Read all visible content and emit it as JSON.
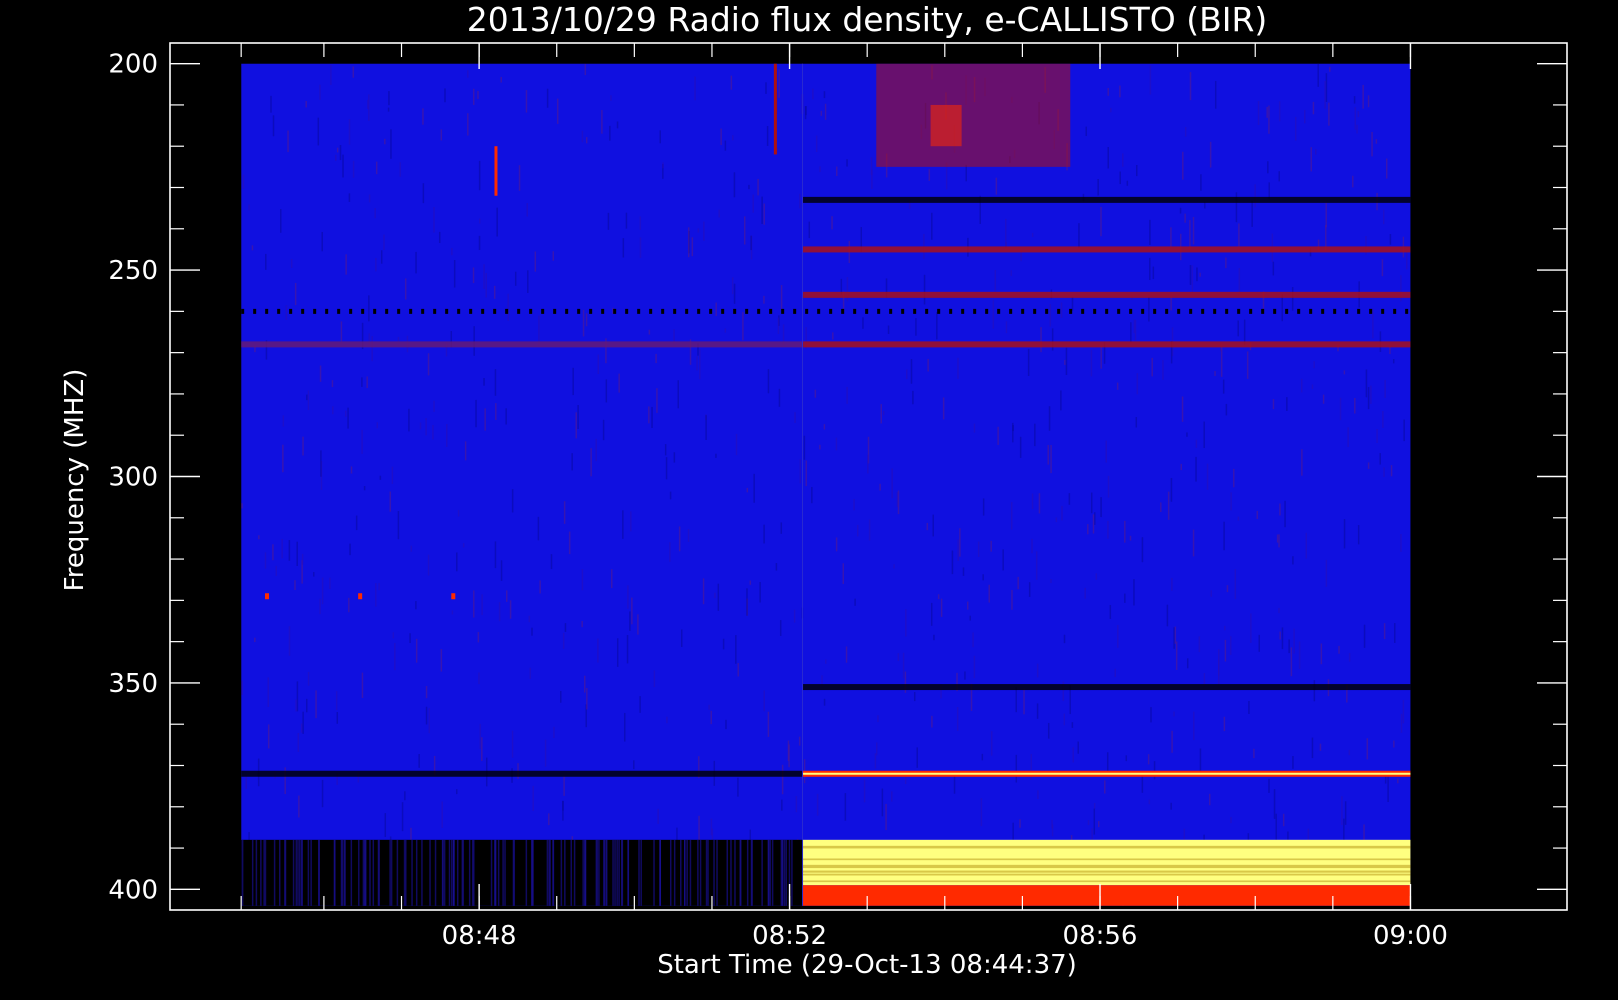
{
  "chart_data": {
    "type": "heatmap",
    "title": "2013/10/29  Radio flux density, e-CALLISTO (BIR)",
    "xlabel": "Start Time (29-Oct-13 08:44:37)",
    "ylabel": "Frequency (MHZ)",
    "x_range_minutes": [
      -0.6,
      17.4
    ],
    "data_x_range_minutes": [
      0.317,
      15.383
    ],
    "y_range_mhz": [
      195,
      405
    ],
    "data_y_range_mhz": [
      200,
      404
    ],
    "y_inverted": true,
    "x_ticks": [
      {
        "label": "08:48",
        "minute": 3.383
      },
      {
        "label": "08:52",
        "minute": 7.383
      },
      {
        "label": "08:56",
        "minute": 11.383
      },
      {
        "label": "09:00",
        "minute": 15.383
      }
    ],
    "y_ticks": [
      {
        "label": "200",
        "mhz": 200
      },
      {
        "label": "250",
        "mhz": 250
      },
      {
        "label": "300",
        "mhz": 300
      },
      {
        "label": "350",
        "mhz": 350
      },
      {
        "label": "400",
        "mhz": 400
      }
    ],
    "colormap": [
      "#000000",
      "#1010e0",
      "#b01010",
      "#ff2a00",
      "#ffff80"
    ],
    "background_color": "#1010e0",
    "regime_change_minute": 7.55,
    "features": [
      {
        "kind": "horizontal-band",
        "mhz": [
          388,
          404
        ],
        "minutes": [
          0.317,
          7.55
        ],
        "level": "low"
      },
      {
        "kind": "horizontal-band",
        "mhz": [
          388,
          399
        ],
        "minutes": [
          7.55,
          15.383
        ],
        "level": "very-high"
      },
      {
        "kind": "horizontal-band",
        "mhz": [
          399,
          404
        ],
        "minutes": [
          7.55,
          15.383
        ],
        "level": "high"
      },
      {
        "kind": "horizontal-line",
        "mhz": 372,
        "minutes": [
          7.55,
          15.383
        ],
        "level": "high"
      },
      {
        "kind": "horizontal-line",
        "mhz": 372,
        "minutes": [
          0.317,
          7.55
        ],
        "level": "low"
      },
      {
        "kind": "horizontal-line",
        "mhz": 351,
        "minutes": [
          7.55,
          15.383
        ],
        "level": "low"
      },
      {
        "kind": "horizontal-line",
        "mhz": 233,
        "minutes": [
          7.55,
          15.383
        ],
        "level": "low"
      },
      {
        "kind": "horizontal-line",
        "mhz": 245,
        "minutes": [
          7.55,
          15.383
        ],
        "level": "medium"
      },
      {
        "kind": "horizontal-line",
        "mhz": 256,
        "minutes": [
          7.55,
          15.383
        ],
        "level": "medium"
      },
      {
        "kind": "horizontal-line",
        "mhz": 268,
        "minutes": [
          7.55,
          15.383
        ],
        "level": "medium"
      },
      {
        "kind": "horizontal-line",
        "mhz": 268,
        "minutes": [
          0.317,
          7.55
        ],
        "level": "medium-faint"
      },
      {
        "kind": "dashed-line",
        "mhz": 260,
        "minutes": [
          0.317,
          15.383
        ],
        "level": "low"
      },
      {
        "kind": "patch",
        "mhz": [
          200,
          225
        ],
        "minutes": [
          8.5,
          11.0
        ],
        "level": "medium"
      },
      {
        "kind": "patch",
        "mhz": [
          210,
          220
        ],
        "minutes": [
          9.2,
          9.6
        ],
        "level": "high"
      },
      {
        "kind": "burst",
        "mhz": [
          220,
          232
        ],
        "minute": 3.6,
        "level": "high"
      },
      {
        "kind": "burst",
        "mhz": [
          200,
          222
        ],
        "minute": 7.2,
        "level": "medium"
      },
      {
        "kind": "spot",
        "mhz": 329,
        "minute": 0.65,
        "level": "high"
      },
      {
        "kind": "spot",
        "mhz": 329,
        "minute": 1.85,
        "level": "high"
      },
      {
        "kind": "spot",
        "mhz": 329,
        "minute": 3.05,
        "level": "high"
      }
    ]
  }
}
